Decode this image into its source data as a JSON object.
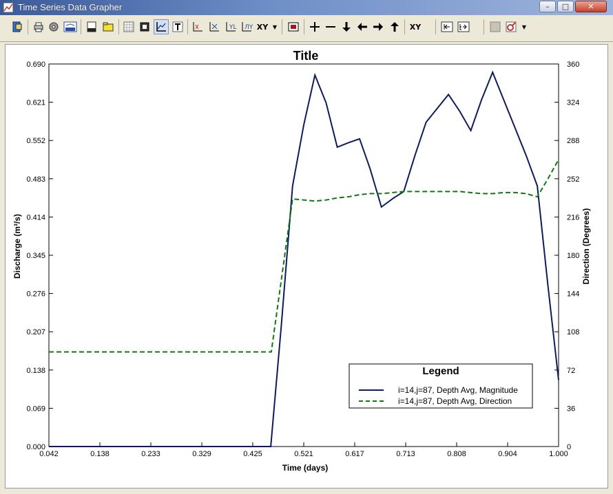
{
  "window": {
    "title": "Time Series Data Grapher"
  },
  "toolbar": {
    "xy_label": "XY",
    "xy_button_label": "XY"
  },
  "chart_data": {
    "type": "line",
    "title": "Title",
    "xlabel": "Time (days)",
    "ylabel_left": "Discharge (m³/s)",
    "ylabel_right": "Direction (Degrees)",
    "xlim": [
      0.042,
      1.0
    ],
    "ylim_left": [
      0,
      0.69
    ],
    "ylim_right": [
      0,
      360
    ],
    "x_ticks": [
      "0.042",
      "0.138",
      "0.233",
      "0.329",
      "0.425",
      "0.521",
      "0.617",
      "0.713",
      "0.808",
      "0.904",
      "1.000"
    ],
    "y_left_ticks": [
      "0.000",
      "0.069",
      "0.138",
      "0.207",
      "0.276",
      "0.345",
      "0.414",
      "0.483",
      "0.552",
      "0.621",
      "0.690"
    ],
    "y_right_ticks": [
      "0",
      "36",
      "72",
      "108",
      "144",
      "180",
      "216",
      "252",
      "288",
      "324",
      "360"
    ],
    "grid": false,
    "legend": {
      "title": "Legend",
      "position": "bottom-right"
    },
    "series": [
      {
        "name": "i=14,j=87, Depth Avg, Magnitude",
        "axis": "left",
        "color": "#0d1a5c",
        "style": "solid",
        "x": [
          0.042,
          0.459,
          0.479,
          0.5,
          0.521,
          0.542,
          0.563,
          0.584,
          0.605,
          0.626,
          0.646,
          0.667,
          0.688,
          0.709,
          0.73,
          0.751,
          0.772,
          0.793,
          0.814,
          0.835,
          0.855,
          0.876,
          0.897,
          0.918,
          0.939,
          0.96,
          0.98,
          1.0
        ],
        "y": [
          0.0,
          0.0,
          0.22,
          0.47,
          0.58,
          0.67,
          0.62,
          0.54,
          0.548,
          0.555,
          0.5,
          0.432,
          0.447,
          0.46,
          0.525,
          0.585,
          0.61,
          0.635,
          0.605,
          0.57,
          0.625,
          0.675,
          0.625,
          0.575,
          0.525,
          0.47,
          0.29,
          0.12
        ]
      },
      {
        "name": "i=14,j=87, Depth Avg, Direction",
        "axis": "right",
        "color": "#0e7a0e",
        "style": "dashed",
        "x": [
          0.042,
          0.46,
          0.5,
          0.521,
          0.542,
          0.563,
          0.584,
          0.605,
          0.626,
          0.646,
          0.667,
          0.688,
          0.709,
          0.73,
          0.751,
          0.772,
          0.793,
          0.814,
          0.835,
          0.855,
          0.876,
          0.897,
          0.918,
          0.939,
          0.96,
          0.98,
          1.0
        ],
        "y": [
          89,
          89,
          233,
          232,
          231,
          232,
          234,
          235,
          237,
          238,
          238,
          239,
          240,
          240,
          240,
          240,
          240,
          240,
          239,
          238,
          238,
          239,
          239,
          238,
          235,
          252,
          270
        ]
      }
    ]
  }
}
